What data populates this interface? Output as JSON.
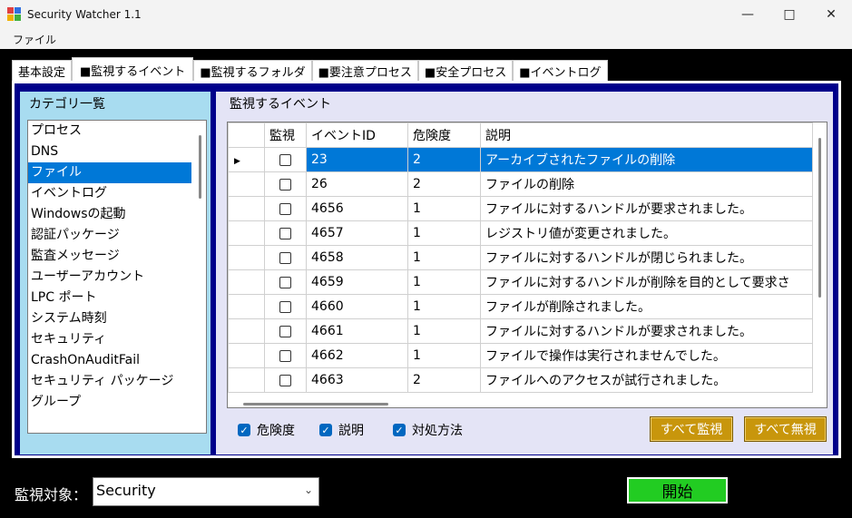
{
  "window": {
    "title": "Security Watcher 1.1"
  },
  "menu": {
    "file": "ファイル"
  },
  "tabs": [
    {
      "label": "基本設定"
    },
    {
      "label": "■監視するイベント"
    },
    {
      "label": "■監視するフォルダ"
    },
    {
      "label": "■要注意プロセス"
    },
    {
      "label": "■安全プロセス"
    },
    {
      "label": "■イベントログ"
    }
  ],
  "category": {
    "title": "カテゴリ一覧",
    "items": [
      "プロセス",
      "DNS",
      "ファイル",
      "イベントログ",
      "Windowsの起動",
      "認証パッケージ",
      "監査メッセージ",
      "ユーザーアカウント",
      "LPC ポート",
      "システム時刻",
      "セキュリティ",
      "CrashOnAuditFail",
      "セキュリティ パッケージ",
      "グループ"
    ],
    "selected": "ファイル"
  },
  "events": {
    "title": "監視するイベント",
    "columns": {
      "watch": "監視",
      "event_id": "イベントID",
      "risk": "危険度",
      "desc": "説明"
    },
    "rows": [
      {
        "id": "23",
        "risk": "2",
        "desc": "アーカイブされたファイルの削除"
      },
      {
        "id": "26",
        "risk": "2",
        "desc": "ファイルの削除"
      },
      {
        "id": "4656",
        "risk": "1",
        "desc": "ファイルに対するハンドルが要求されました。"
      },
      {
        "id": "4657",
        "risk": "1",
        "desc": "レジストリ値が変更されました。"
      },
      {
        "id": "4658",
        "risk": "1",
        "desc": "ファイルに対するハンドルが閉じられました。"
      },
      {
        "id": "4659",
        "risk": "1",
        "desc": "ファイルに対するハンドルが削除を目的として要求さ"
      },
      {
        "id": "4660",
        "risk": "1",
        "desc": "ファイルが削除されました。"
      },
      {
        "id": "4661",
        "risk": "1",
        "desc": "ファイルに対するハンドルが要求されました。"
      },
      {
        "id": "4662",
        "risk": "1",
        "desc": "ファイルで操作は実行されませんでした。"
      },
      {
        "id": "4663",
        "risk": "2",
        "desc": "ファイルへのアクセスが試行されました。"
      }
    ],
    "options": {
      "risk": "危険度",
      "desc": "説明",
      "remedy": "対処方法"
    },
    "buttons": {
      "watch_all": "すべて監視",
      "ignore_all": "すべて無視"
    }
  },
  "footer": {
    "target_label": "監視対象：",
    "target_value": "Security",
    "start": "開始"
  },
  "colors": {
    "panel": "#00008b",
    "category_bg": "#a8dcf0",
    "selection": "#0078d7",
    "gold_button": "#c8960c",
    "start_button": "#22cc22"
  }
}
